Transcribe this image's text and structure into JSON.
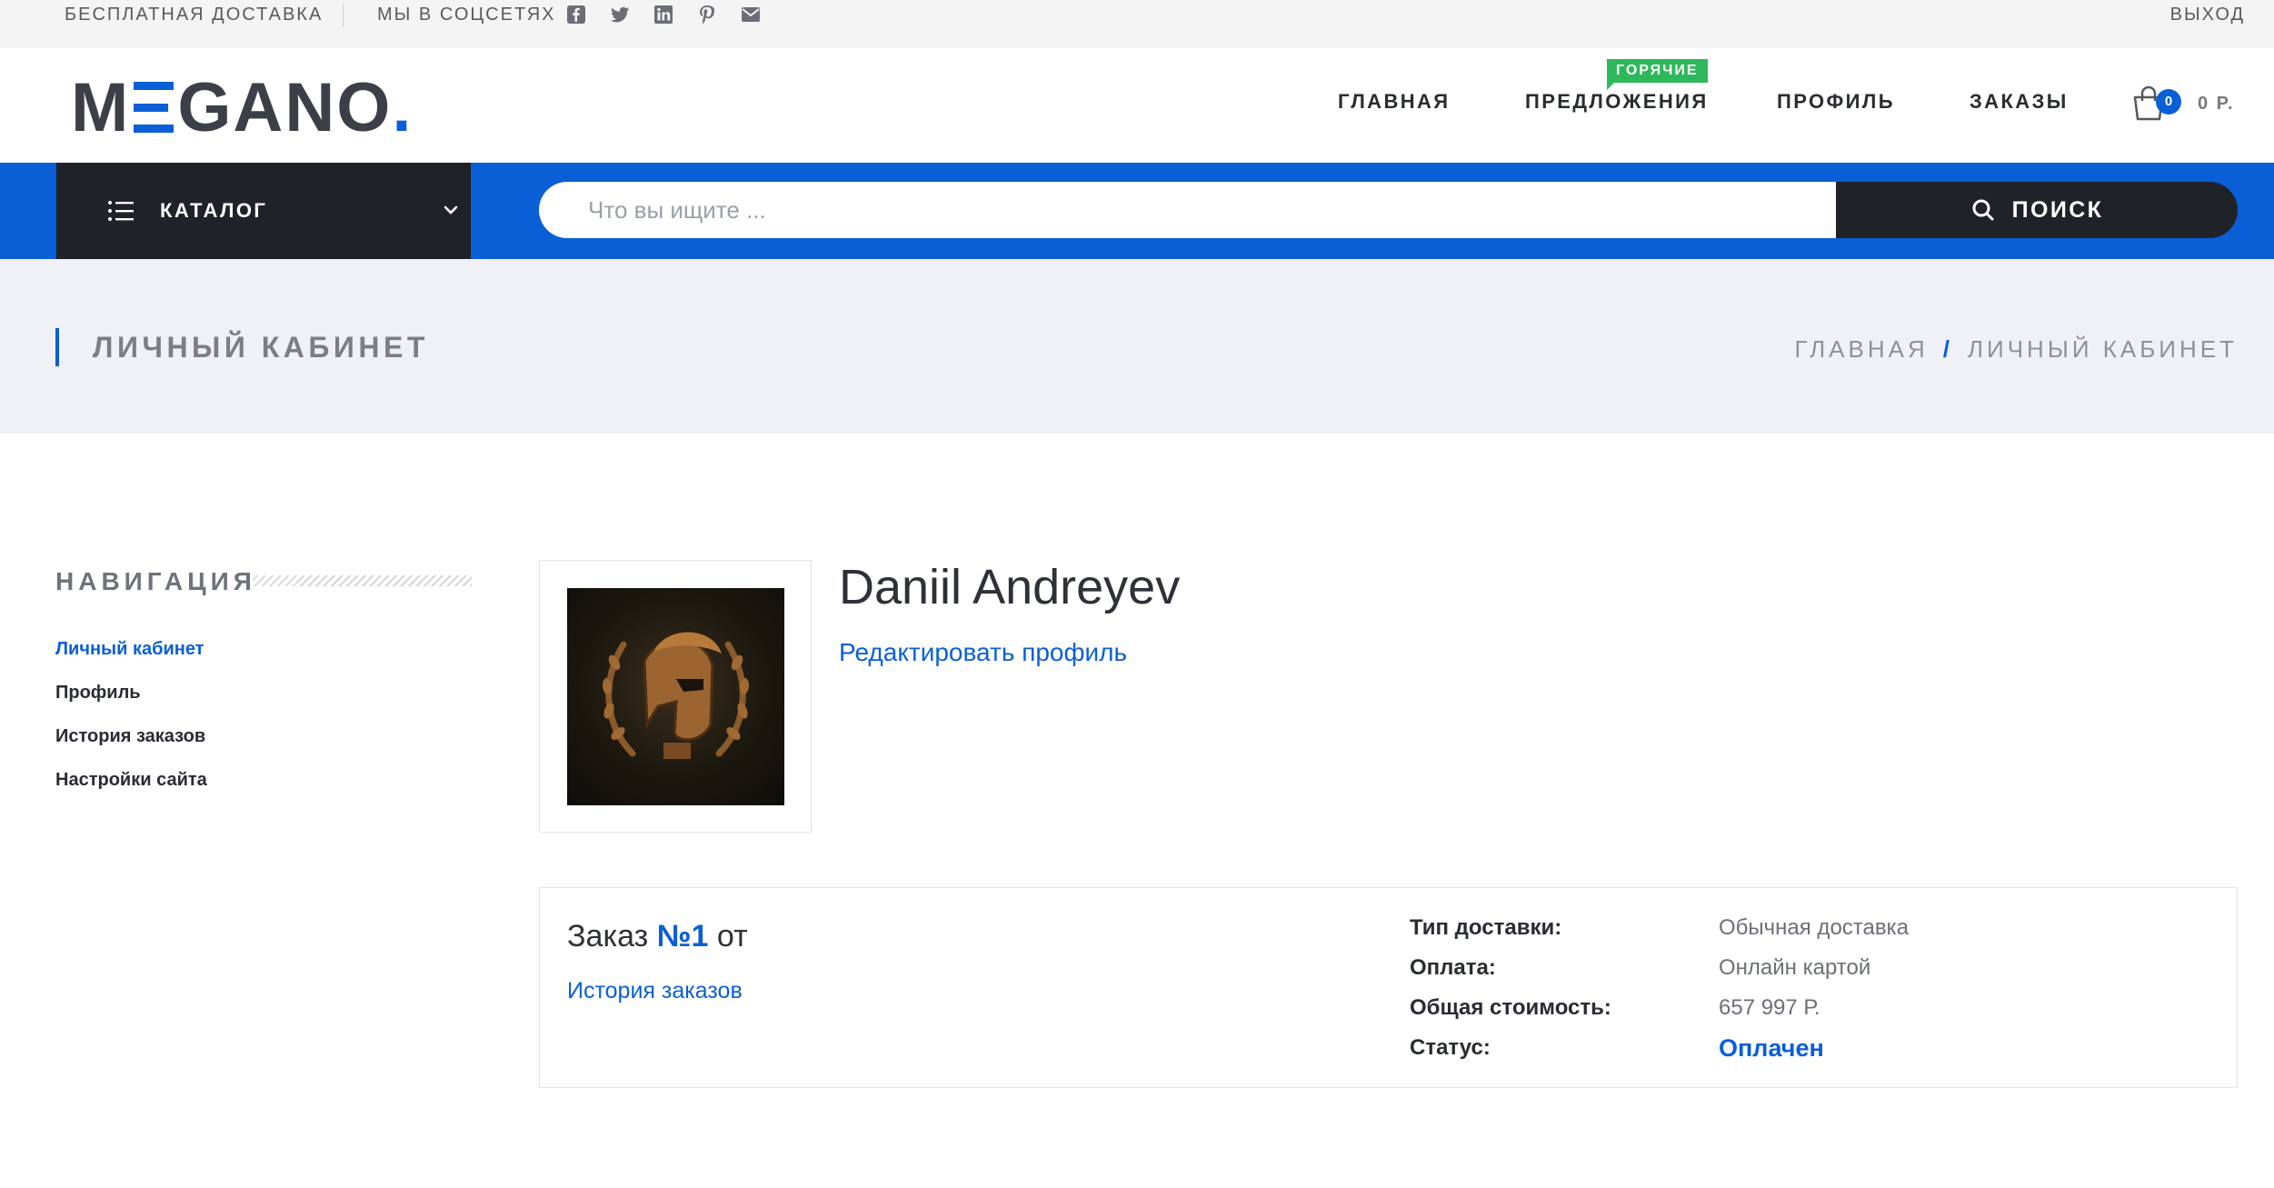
{
  "topbar": {
    "free_delivery": "БЕСПЛАТНАЯ ДОСТАВКА",
    "social_label": "МЫ В СОЦСЕТЯХ",
    "socials": [
      "facebook-icon",
      "twitter-icon",
      "linkedin-icon",
      "pinterest-icon",
      "email-icon"
    ],
    "logout": "ВЫХОД"
  },
  "header": {
    "logo_left": "M",
    "logo_right": "GANO",
    "logo_dot": ".",
    "hot_badge": "ГОРЯЧИЕ",
    "nav": [
      {
        "label": "ГЛАВНАЯ"
      },
      {
        "label": "ПРЕДЛОЖЕНИЯ"
      },
      {
        "label": "ПРОФИЛЬ"
      },
      {
        "label": "ЗАКАЗЫ"
      }
    ],
    "cart_count": "0",
    "cart_sum": "0 Р."
  },
  "searchbar": {
    "catalog_label": "КАТАЛОГ",
    "placeholder": "Что вы ищите ...",
    "button_label": "ПОИСК"
  },
  "titleband": {
    "title": "ЛИЧНЫЙ КАБИНЕТ",
    "breadcrumb": [
      "ГЛАВНАЯ",
      "/",
      "ЛИЧНЫЙ КАБИНЕТ"
    ]
  },
  "sidebar": {
    "title": "НАВИГАЦИЯ",
    "items": [
      {
        "label": "Личный кабинет",
        "active": true
      },
      {
        "label": "Профиль"
      },
      {
        "label": "История заказов"
      },
      {
        "label": "Настройки сайта"
      }
    ]
  },
  "profile": {
    "name": "Daniil Andreyev",
    "edit_link": "Редактировать профиль"
  },
  "order": {
    "prefix": "Заказ",
    "number": "№1",
    "suffix": "от",
    "history_link": "История заказов",
    "details": [
      {
        "key": "Тип доставки:",
        "value": "Обычная доставка"
      },
      {
        "key": "Оплата:",
        "value": "Онлайн картой"
      },
      {
        "key": "Общая стоимость:",
        "value": "657 997 Р."
      },
      {
        "key": "Статус:",
        "value": "Оплачен"
      }
    ]
  },
  "colors": {
    "accent": "#0a5fd6",
    "dark": "#1f2228",
    "badge": "#2eb85c",
    "band": "#eff1f6"
  }
}
